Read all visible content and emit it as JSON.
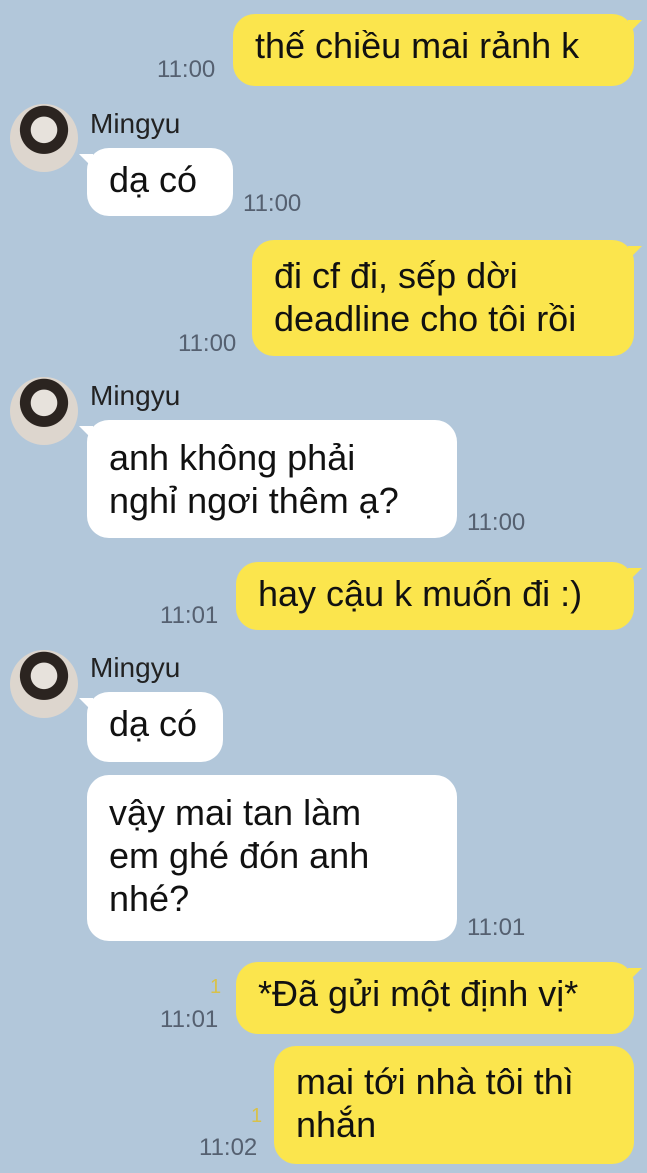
{
  "contact": {
    "name": "Mingyu"
  },
  "messages": [
    {
      "id": "m1",
      "from": "me",
      "text": "thế chiều mai rảnh k",
      "time": "11:00"
    },
    {
      "id": "m2",
      "from": "them",
      "text": "dạ có",
      "time": "11:00"
    },
    {
      "id": "m3",
      "from": "me",
      "text": "đi cf đi, sếp dời\ndeadline cho tôi rồi",
      "time": "11:00"
    },
    {
      "id": "m4",
      "from": "them",
      "text": "anh không phải\nnghỉ ngơi thêm ạ?",
      "time": "11:00"
    },
    {
      "id": "m5",
      "from": "me",
      "text": "hay cậu k muốn đi :)",
      "time": "11:01"
    },
    {
      "id": "m6",
      "from": "them",
      "text": "dạ có"
    },
    {
      "id": "m7",
      "from": "them",
      "text": "vậy mai tan làm\nem ghé đón anh\nnhé?",
      "time": "11:01"
    },
    {
      "id": "m8",
      "from": "me",
      "text": "*Đã gửi một định vị*",
      "time": "11:01",
      "unread": "1"
    },
    {
      "id": "m9",
      "from": "me",
      "text": "mai tới nhà tôi thì\nnhắn",
      "time": "11:02",
      "unread": "1"
    }
  ],
  "colors": {
    "background": "#b2c7da",
    "my_bubble": "#fbe54d",
    "their_bubble": "#ffffff",
    "unread": "#d8c14a"
  }
}
